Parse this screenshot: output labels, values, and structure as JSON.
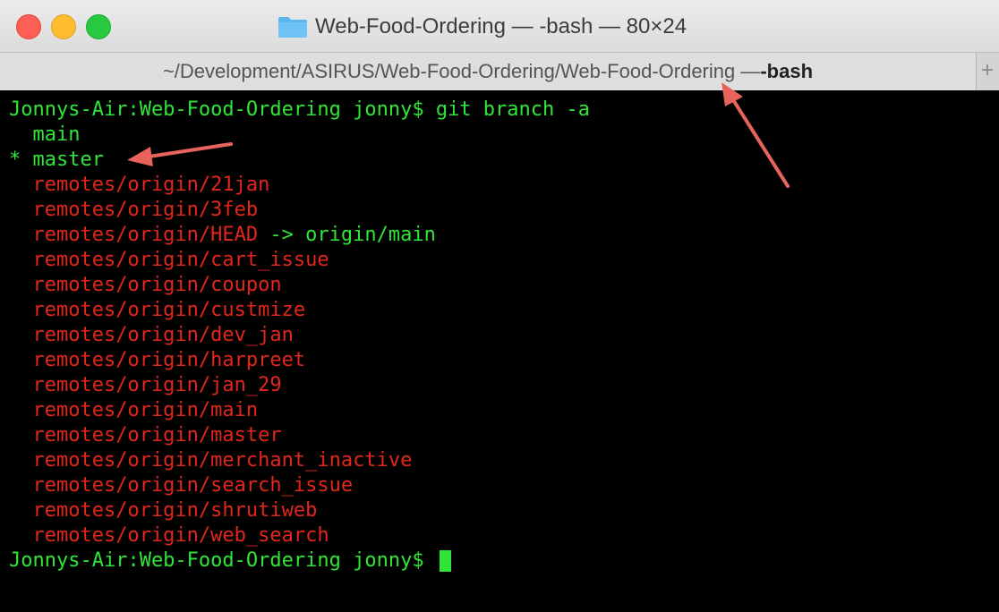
{
  "window": {
    "title": "Web-Food-Ordering — -bash — 80×24",
    "buttons": [
      "close",
      "minimize",
      "zoom"
    ]
  },
  "tab": {
    "path": "~/Development/ASIRUS/Web-Food-Ordering/Web-Food-Ordering — ",
    "process": "-bash",
    "new_tab_glyph": "+"
  },
  "terminal": {
    "prompt": "Jonnys-Air:Web-Food-Ordering jonny$ ",
    "command": "git branch -a",
    "local_branches": [
      {
        "marker": "  ",
        "name": "main"
      },
      {
        "marker": "* ",
        "name": "master"
      }
    ],
    "remote_branches": [
      "remotes/origin/21jan",
      "remotes/origin/3feb",
      "remotes/origin/HEAD",
      "remotes/origin/cart_issue",
      "remotes/origin/coupon",
      "remotes/origin/custmize",
      "remotes/origin/dev_jan",
      "remotes/origin/harpreet",
      "remotes/origin/jan_29",
      "remotes/origin/main",
      "remotes/origin/master",
      "remotes/origin/merchant_inactive",
      "remotes/origin/search_issue",
      "remotes/origin/shrutiweb",
      "remotes/origin/web_search"
    ],
    "head_target": " -> origin/main",
    "final_prompt": "Jonnys-Air:Web-Food-Ordering jonny$ ",
    "colors": {
      "green": "#2fe637",
      "red": "#e2261a",
      "background": "#000000"
    }
  },
  "annotations": {
    "arrow_color": "#e8635c",
    "arrows": [
      "points-to-master-branch",
      "points-to-tab-path"
    ]
  }
}
